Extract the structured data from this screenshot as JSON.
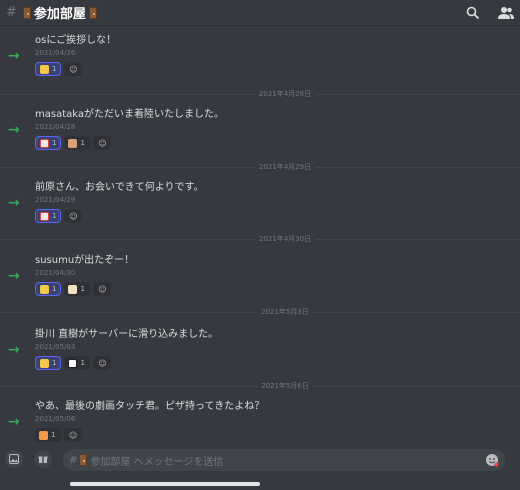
{
  "header": {
    "channel_name": "参加部屋",
    "search_icon": "search-icon",
    "members_icon": "members-icon"
  },
  "messages": [
    {
      "text": "osにご挨拶しな！",
      "date": "2021/04/26",
      "reactions": [
        {
          "count": "1",
          "color": "#f2c94c"
        }
      ]
    },
    {
      "text": "masatakaがただいま着陸いたしました。",
      "date": "2021/04/28",
      "reactions": [
        {
          "count": "1",
          "color": "#e9e9e9"
        },
        {
          "count": "1",
          "color": "#d9a27a"
        }
      ]
    },
    {
      "text": "前原さん、お会いできて何よりです。",
      "date": "2021/04/29",
      "reactions": [
        {
          "count": "1",
          "color": "#e9e9e9"
        }
      ]
    },
    {
      "text": "susumuが出たぞー！",
      "date": "2021/04/30",
      "reactions": [
        {
          "count": "1",
          "color": "#f2c94c"
        },
        {
          "count": "1",
          "color": "#f4e3c2"
        }
      ]
    },
    {
      "text": "掛川 直樹がサーバーに滑り込みました。",
      "date": "2021/05/03",
      "reactions": [
        {
          "count": "1",
          "color": "#f2c94c"
        },
        {
          "count": "1",
          "color": "#ffffff"
        }
      ]
    },
    {
      "text": "やあ、最後の劇画タッチ君。ピザ持ってきたよね？",
      "date": "2021/05/06",
      "reactions": [
        {
          "count": "1",
          "color": "#f2994a"
        }
      ]
    }
  ],
  "dividers": [
    "2021年4月28日",
    "2021年4月29日",
    "2021年4月30日",
    "2021年5月3日",
    "2021年5月6日"
  ],
  "composer": {
    "placeholder": "参加部屋 へメッセージを送信"
  }
}
